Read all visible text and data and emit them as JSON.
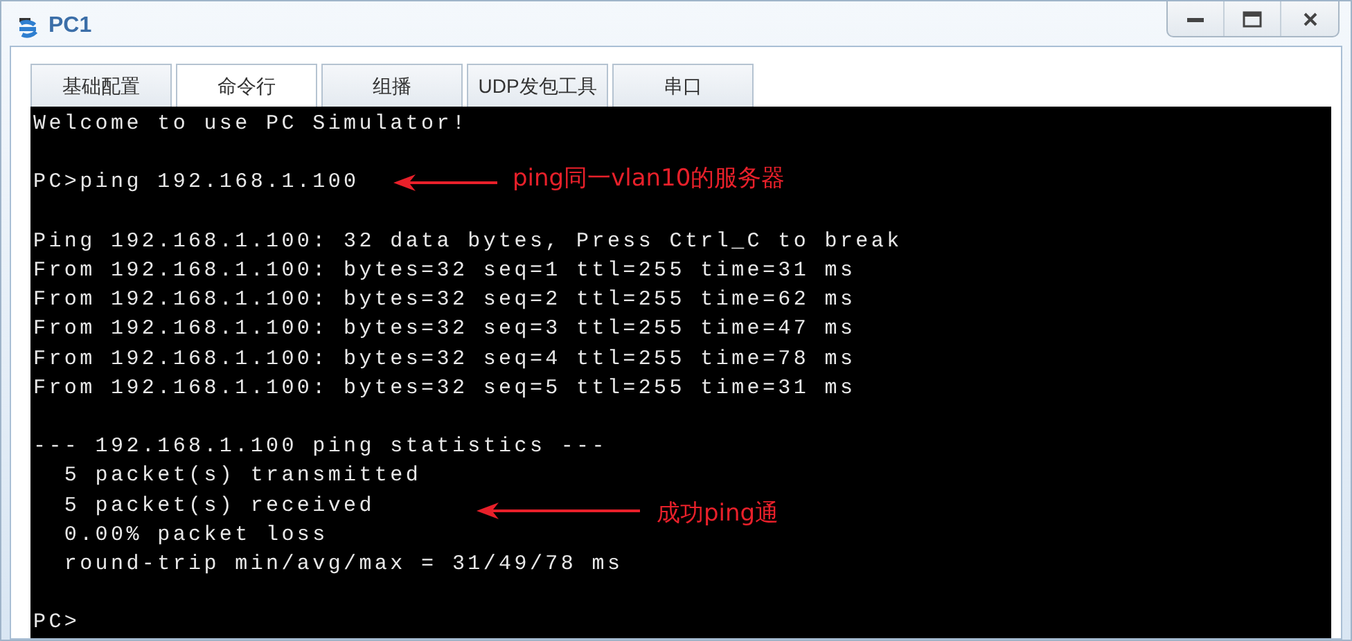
{
  "window": {
    "title": "PC1"
  },
  "tabs": [
    {
      "label": "基础配置",
      "selected": false
    },
    {
      "label": "命令行",
      "selected": true
    },
    {
      "label": "组播",
      "selected": false
    },
    {
      "label": "UDP发包工具",
      "selected": false
    },
    {
      "label": "串口",
      "selected": false
    }
  ],
  "terminal": {
    "blocks": [
      [
        "Welcome to use PC Simulator!"
      ],
      [
        "PC>ping 192.168.1.100"
      ],
      [
        "Ping 192.168.1.100: 32 data bytes, Press Ctrl_C to break",
        "From 192.168.1.100: bytes=32 seq=1 ttl=255 time=31 ms",
        "From 192.168.1.100: bytes=32 seq=2 ttl=255 time=62 ms",
        "From 192.168.1.100: bytes=32 seq=3 ttl=255 time=47 ms",
        "From 192.168.1.100: bytes=32 seq=4 ttl=255 time=78 ms",
        "From 192.168.1.100: bytes=32 seq=5 ttl=255 time=31 ms"
      ],
      [
        "--- 192.168.1.100 ping statistics ---",
        "  5 packet(s) transmitted",
        "  5 packet(s) received",
        "  0.00% packet loss",
        "  round-trip min/avg/max = 31/49/78 ms"
      ],
      [
        "PC>"
      ]
    ]
  },
  "annotations": [
    {
      "text": "ping同一vlan10的服务器"
    },
    {
      "text": "成功ping通"
    }
  ]
}
